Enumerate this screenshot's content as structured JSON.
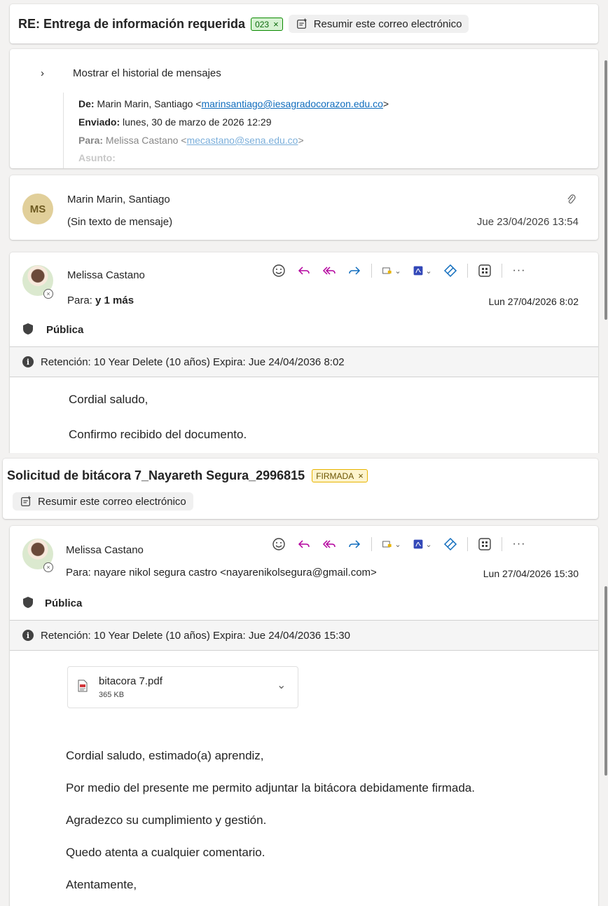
{
  "email1": {
    "subject": "RE: Entrega de información requerida",
    "tag": "023",
    "summarize_label": "Resumir este correo electrónico",
    "history": {
      "toggle_label": "Mostrar el historial de mensajes",
      "from_label": "De:",
      "from_name": "Marin Marin, Santiago <",
      "from_email": "marinsantiago@iesagradocorazon.edu.co",
      "from_close": ">",
      "sent_label": "Enviado:",
      "sent_value": "lunes, 30 de marzo de 2026 12:29",
      "to_label": "Para:",
      "to_name": "Melissa Castano <",
      "to_email": "mecastano@sena.edu.co",
      "to_close": ">",
      "subject_label": "Asunto:"
    },
    "collapsed_message": {
      "avatar_initials": "MS",
      "sender": "Marin Marin, Santiago",
      "preview": "(Sin texto de mensaje)",
      "date": "Jue 23/04/2026 13:54"
    },
    "message": {
      "sender": "Melissa Castano",
      "to_label": "Para:",
      "to_value": "y 1 más",
      "date": "Lun 27/04/2026 8:02",
      "sensitivity": "Pública",
      "retention": "Retención: 10 Year Delete (10 años) Expira: Jue 24/04/2036 8:02",
      "body": [
        "Cordial saludo,",
        "Confirmo recibido del documento."
      ]
    }
  },
  "email2": {
    "subject": "Solicitud de bitácora 7_Nayareth Segura_2996815",
    "tag": "FIRMADA",
    "summarize_label": "Resumir este correo electrónico",
    "message": {
      "sender": "Melissa Castano",
      "to_label": "Para:",
      "to_value": "nayare nikol segura castro <nayarenikolsegura@gmail.com>",
      "date": "Lun 27/04/2026 15:30",
      "sensitivity": "Pública",
      "retention": "Retención: 10 Year Delete (10 años) Expira: Jue 24/04/2036 15:30",
      "attachment": {
        "name": "bitacora 7.pdf",
        "size": "365 KB"
      },
      "body": [
        "Cordial saludo, estimado(a) aprendiz,",
        "Por medio del presente me permito adjuntar la bitácora debidamente firmada.",
        "Agradezco su cumplimiento y gestión.",
        "Quedo atenta a cualquier comentario.",
        "Atentamente,"
      ]
    }
  },
  "colors": {
    "accent": "#0f6cbd",
    "tag_green": "#0b8a00",
    "tag_yellow": "#e8b400",
    "avatar_ms": "#e1cf9a"
  },
  "icons": [
    "summarize-icon",
    "chevron-right-icon",
    "paperclip-icon",
    "emoji-icon",
    "reply-icon",
    "reply-all-icon",
    "forward-icon",
    "rules-icon",
    "pdf-icon",
    "loop-icon",
    "apps-icon",
    "more-icon",
    "shield-icon",
    "info-icon",
    "file-icon",
    "chevron-down-icon",
    "close-icon"
  ]
}
